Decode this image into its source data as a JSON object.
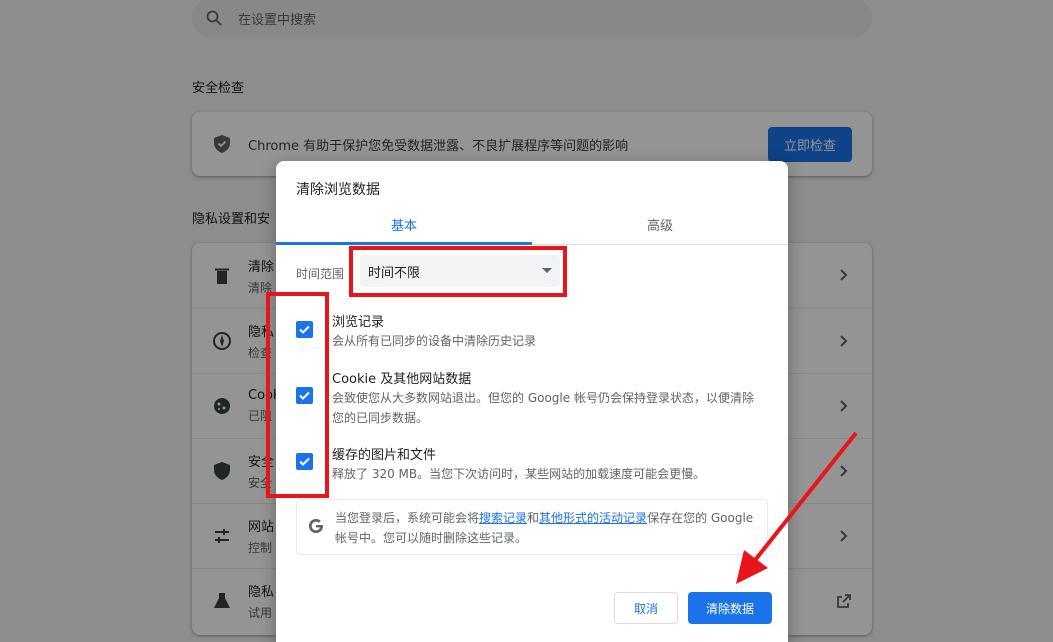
{
  "search": {
    "placeholder": "在设置中搜索"
  },
  "safety_check": {
    "section_title": "安全检查",
    "description": "Chrome 有助于保护您免受数据泄露、不良扩展程序等问题的影响",
    "button": "立即检查"
  },
  "privacy": {
    "section_title": "隐私设置和安",
    "rows": [
      {
        "title": "清除",
        "subtitle": "清除"
      },
      {
        "title": "隐私",
        "subtitle": "检查"
      },
      {
        "title": "Cook",
        "subtitle": "已阻"
      },
      {
        "title": "安全",
        "subtitle": "安全"
      },
      {
        "title": "网站",
        "subtitle": "控制"
      },
      {
        "title": "隐私",
        "subtitle": "试用"
      }
    ]
  },
  "dialog": {
    "title": "清除浏览数据",
    "tabs": [
      "基本",
      "高级"
    ],
    "active_tab": "基本",
    "time_range_label": "时间范围",
    "time_range_value": "时间不限",
    "options": [
      {
        "title": "浏览记录",
        "desc": "会从所有已同步的设备中清除历史记录",
        "checked": true
      },
      {
        "title": "Cookie 及其他网站数据",
        "desc": "会致使您从大多数网站退出。但您的 Google 帐号仍会保持登录状态，以便清除您的已同步数据。",
        "checked": true
      },
      {
        "title": "缓存的图片和文件",
        "desc": "释放了 320 MB。当您下次访问时，某些网站的加载速度可能会更慢。",
        "checked": true
      }
    ],
    "info": {
      "prefix": "当您登录后，系统可能会将",
      "link1": "搜索记录",
      "mid": "和",
      "link2": "其他形式的活动记录",
      "suffix": "保存在您的 Google 帐号中。您可以随时删除这些记录。"
    },
    "cancel_button": "取消",
    "clear_button": "清除数据"
  },
  "colors": {
    "accent": "#1a73e8",
    "annotation": "#e8151b"
  },
  "icons": [
    "search-icon",
    "shield-icon",
    "trash-icon",
    "compass-icon",
    "cookie-icon",
    "security-shield-icon",
    "sliders-icon",
    "flask-icon",
    "chevron-right-icon",
    "external-link-icon",
    "google-g-icon",
    "checkmark-icon",
    "dropdown-caret-icon"
  ]
}
